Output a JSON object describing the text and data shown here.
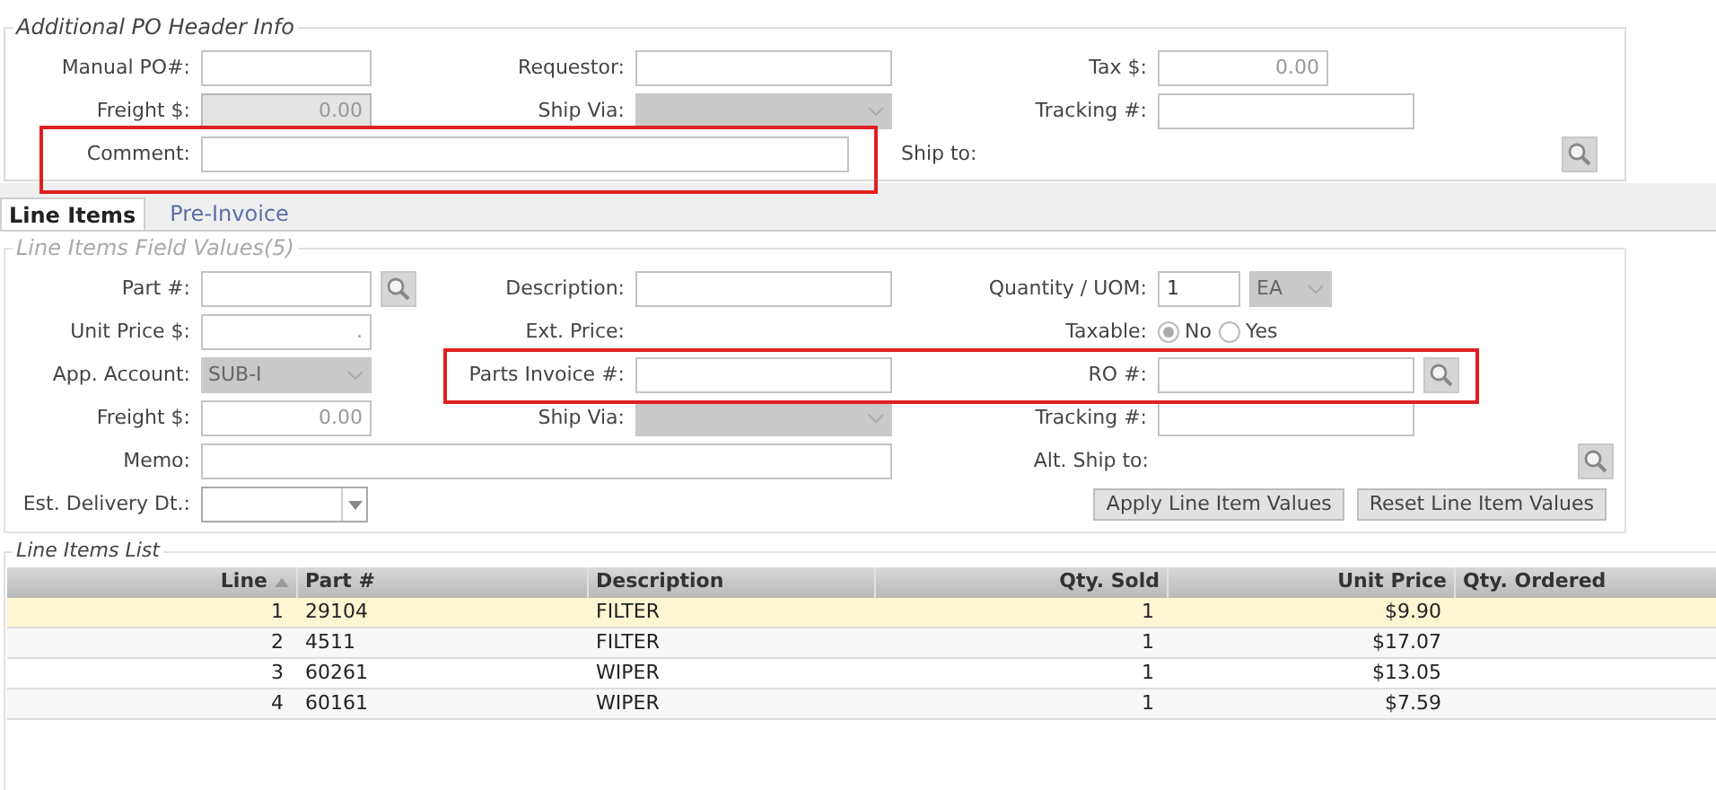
{
  "header": {
    "legend": "Additional PO Header Info",
    "manual_po": {
      "label": "Manual PO#:"
    },
    "requestor": {
      "label": "Requestor:"
    },
    "tax": {
      "label": "Tax $:",
      "value": "0.00"
    },
    "freight": {
      "label": "Freight $:",
      "value": "0.00",
      "disabled": true
    },
    "ship_via": {
      "label": "Ship Via:",
      "disabled": true
    },
    "tracking": {
      "label": "Tracking #:"
    },
    "comment": {
      "label": "Comment:"
    },
    "ship_to": {
      "label": "Ship to:"
    }
  },
  "tabs": [
    {
      "label": "Line Items",
      "selected": true
    },
    {
      "label": "Pre-Invoice",
      "selected": false
    }
  ],
  "line_fields": {
    "legend": "Line Items Field Values(5)",
    "part": {
      "label": "Part #:"
    },
    "description": {
      "label": "Description:"
    },
    "quantity": {
      "label": "Quantity / UOM:",
      "value": "1",
      "uom": "EA",
      "uom_disabled": true
    },
    "unit_price": {
      "label": "Unit Price $:",
      "value": "."
    },
    "ext_price": {
      "label": "Ext. Price:"
    },
    "taxable": {
      "label": "Taxable:",
      "options": [
        {
          "label": "No",
          "selected": true
        },
        {
          "label": "Yes",
          "selected": false
        }
      ]
    },
    "account": {
      "label": "App. Account:",
      "value": "SUB-I",
      "disabled": true
    },
    "parts_invoice": {
      "label": "Parts Invoice #:"
    },
    "ro": {
      "label": "RO #:"
    },
    "freight": {
      "label": "Freight $:",
      "value": "0.00"
    },
    "ship_via": {
      "label": "Ship Via:",
      "disabled": true
    },
    "tracking": {
      "label": "Tracking #:"
    },
    "memo": {
      "label": "Memo:"
    },
    "alt_ship_to": {
      "label": "Alt. Ship to:"
    },
    "delivery": {
      "label": "Est. Delivery Dt.:"
    },
    "buttons": [
      "Apply Line Item Values",
      "Reset Line Item Values"
    ]
  },
  "list": {
    "legend": "Line Items List",
    "columns": [
      "Line",
      "Part #",
      "Description",
      "Qty. Sold",
      "Unit Price",
      "Qty. Ordered"
    ],
    "rows": [
      {
        "cells": [
          "1",
          "29104",
          "FILTER",
          "1",
          "$9.90"
        ],
        "selected": true
      },
      {
        "cells": [
          "2",
          "4511",
          "FILTER",
          "1",
          "$17.07"
        ],
        "selected": false
      },
      {
        "cells": [
          "3",
          "60261",
          "WIPER",
          "1",
          "$13.05"
        ],
        "selected": false
      },
      {
        "cells": [
          "4",
          "60161",
          "WIPER",
          "1",
          "$7.59"
        ],
        "selected": false
      }
    ]
  }
}
